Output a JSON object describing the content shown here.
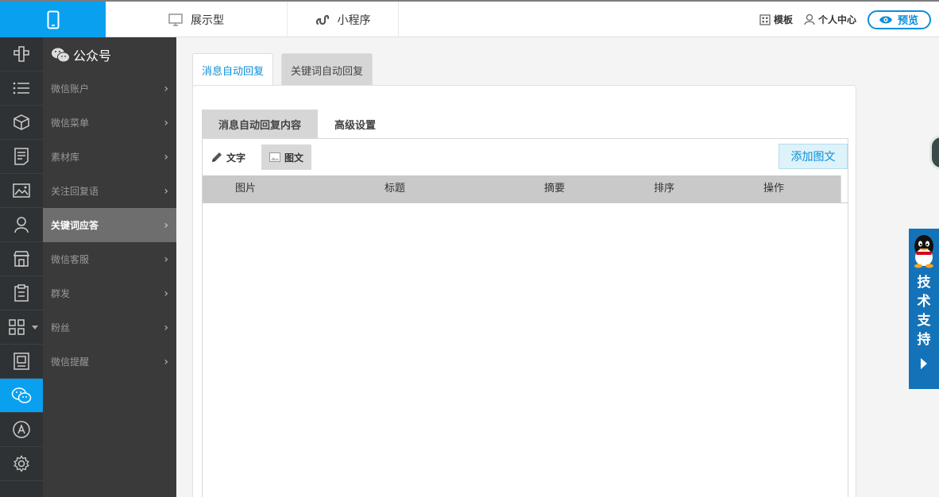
{
  "topbar": {
    "tabs": [
      {
        "label": "展示型",
        "icon": "monitor-icon"
      },
      {
        "label": "小程序",
        "icon": "mini-program-icon"
      }
    ],
    "template_label": "模板",
    "user_center_label": "个人中心",
    "preview_label": "预览"
  },
  "submenu": {
    "title": "公众号",
    "items": [
      {
        "label": "微信账户"
      },
      {
        "label": "微信菜单"
      },
      {
        "label": "素材库"
      },
      {
        "label": "关注回复语"
      },
      {
        "label": "关键词应答"
      },
      {
        "label": "微信客服"
      },
      {
        "label": "群发"
      },
      {
        "label": "粉丝"
      },
      {
        "label": "微信提醒"
      }
    ],
    "active_index": 4
  },
  "main": {
    "tabs": [
      {
        "label": "消息自动回复"
      },
      {
        "label": "关键词自动回复"
      }
    ],
    "sub_tabs": [
      {
        "label": "消息自动回复内容"
      },
      {
        "label": "高级设置"
      }
    ],
    "toolbar": {
      "text_label": "文字",
      "image_text_label": "图文",
      "add_button_label": "添加图文"
    },
    "table": {
      "columns": [
        "图片",
        "标题",
        "摘要",
        "排序",
        "操作"
      ],
      "rows": []
    }
  },
  "support": {
    "label": "技术支持"
  },
  "colors": {
    "accent": "#0aa0f0",
    "rail_bg": "#2f3234",
    "submenu_bg": "#3a3a3a",
    "support_bg": "#1473b8"
  }
}
